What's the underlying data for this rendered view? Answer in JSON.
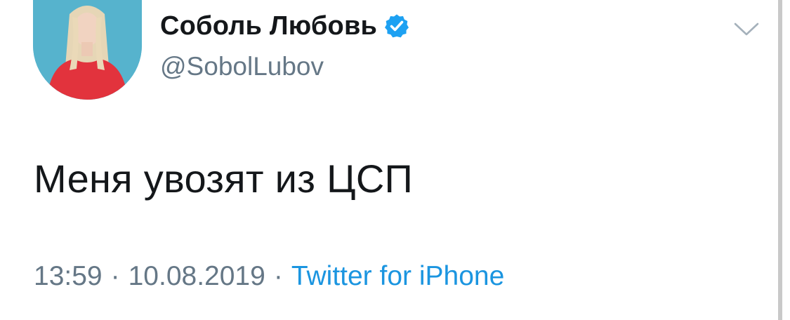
{
  "author": {
    "display_name": "Соболь Любовь",
    "handle": "@SobolLubov",
    "verified": true,
    "verified_icon": "verified-badge-icon"
  },
  "tweet": {
    "text": "Меня увозят из ЦСП"
  },
  "meta": {
    "time": "13:59",
    "separator": "·",
    "date": "10.08.2019",
    "source": "Twitter for iPhone"
  },
  "menu_icon": "chevron-down-icon",
  "colors": {
    "text_primary": "#14171a",
    "text_secondary": "#657786",
    "link": "#1b95e0",
    "verified": "#1da1f2"
  }
}
